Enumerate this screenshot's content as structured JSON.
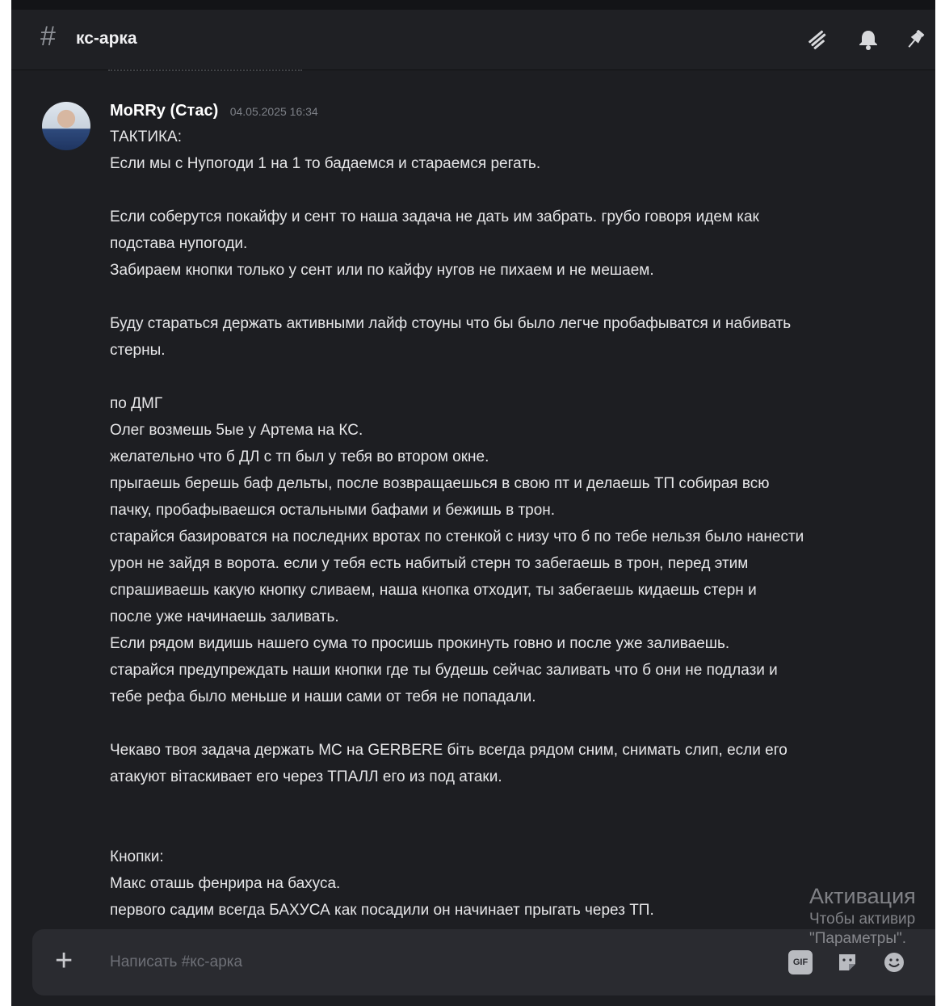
{
  "channel": {
    "icon": "hash-icon",
    "name": "кс-арка"
  },
  "header_icons": [
    "threads-icon",
    "bell-icon",
    "pin-icon"
  ],
  "message": {
    "author": "MoRRy (Стас)",
    "timestamp": "04.05.2025 16:34",
    "lines": [
      "ТАКТИКА:",
      "Если мы с Нупогоди 1  на 1 то бадаемся и стараемся регать.",
      "",
      "Если соберутся покайфу и сент то наша задача не дать им забрать. грубо говоря идем как",
      "подстава нупогоди.",
      "Забираем кнопки только у сент или по кайфу нугов не пихаем и не мешаем.",
      "",
      "Буду стараться держать активными лайф стоуны что бы было легче пробафыватся и набивать",
      "стерны.",
      "",
      "по ДМГ",
      "Олег возмешь 5ые у Артема на КС.",
      "желательно что б ДЛ с тп был у тебя во втором окне.",
      "прыгаешь берешь баф дельты, после возвращаешься в свою пт и делаешь ТП собирая всю",
      "пачку, пробафываешся остальными бафами и бежишь в трон.",
      "старайся базироватся на последних вротах по стенкой с низу что б по тебе нельзя было нанести",
      "урон не зайдя в ворота. если у тебя есть набитый стерн то забегаешь в трон, перед этим",
      "спрашиваешь какую кнопку сливаем, наша кнопка отходит, ты забегаешь кидаешь стерн и",
      "после уже начинаешь заливать.",
      "Если рядом видишь нашего сума то просишь прокинуть говно и после уже заливаешь.",
      "старайся предупреждать наши кнопки где ты будешь сейчас заливать что б они не подлази и",
      "тебе рефа было меньше и наши сами от тебя не попадали.",
      "",
      "Чекаво твоя задача держать МС на GERBERE біть всегда рядом сним, снимать слип, если его",
      "атакуют вітаскивает его через ТПАЛЛ его из под атаки.",
      "",
      "",
      "Кнопки:",
      "Макс оташь фенрира на бахуса.",
      "первого садим всегда БАХУСА как посадили он начинает прыгать через ТП."
    ]
  },
  "composer": {
    "plus_icon": "plus-icon",
    "placeholder": "Написать #кс-арка",
    "icons": [
      "gif-icon",
      "sticker-icon",
      "emoji-icon"
    ],
    "gif_label": "GIF"
  },
  "watermark": {
    "title": "Активация",
    "line1": "Чтобы активир",
    "line2": "\"Параметры\"."
  }
}
